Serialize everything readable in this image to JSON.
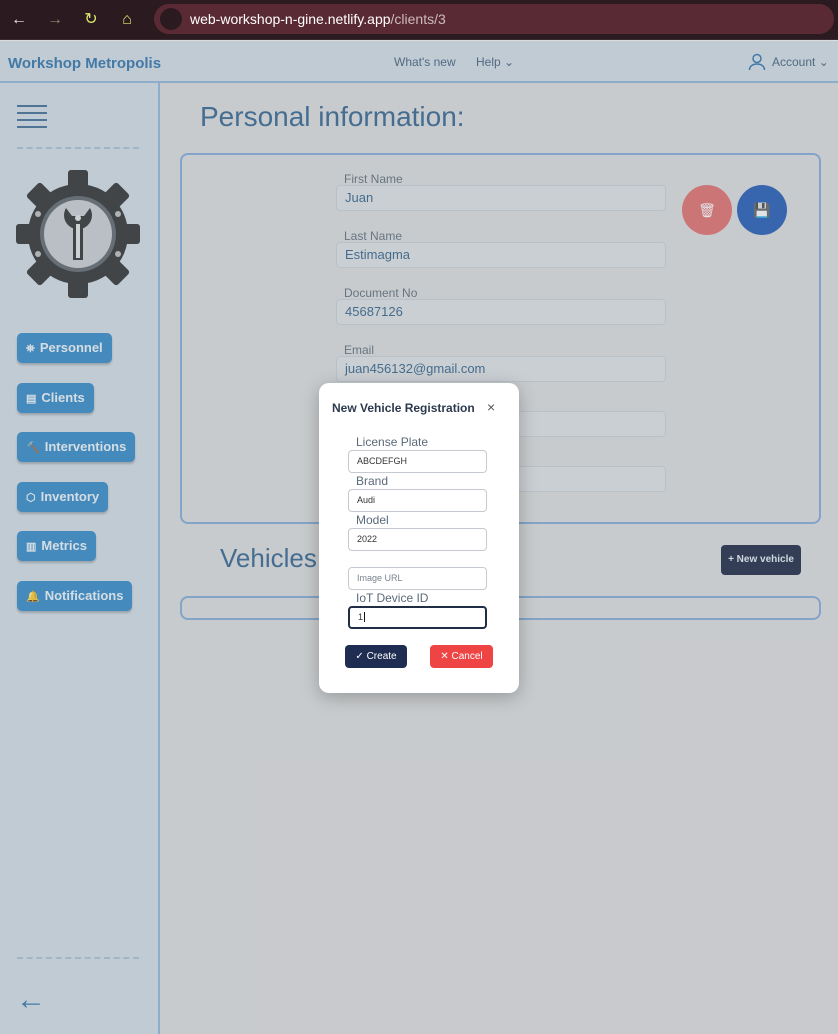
{
  "browser": {
    "url_host": "web-workshop-n-gine.netlify.app",
    "url_path": "/clients/3"
  },
  "app": {
    "brand": "Workshop Metropolis",
    "nav": [
      {
        "label": "What's new"
      },
      {
        "label": "Help"
      }
    ],
    "account_label": "Account"
  },
  "sidebar": {
    "items": [
      {
        "label": "Personnel",
        "icon": "⛯"
      },
      {
        "label": "Clients",
        "icon": "▤"
      },
      {
        "label": "Interventions",
        "icon": "🔨"
      },
      {
        "label": "Inventory",
        "icon": "⬡"
      },
      {
        "label": "Metrics",
        "icon": "▥"
      },
      {
        "label": "Notifications",
        "icon": "🔔"
      }
    ]
  },
  "main": {
    "title": "Personal information:",
    "fields": [
      {
        "label": "First Name",
        "value": "Juan"
      },
      {
        "label": "Last Name",
        "value": "Estimagma"
      },
      {
        "label": "Document No",
        "value": "45687126"
      },
      {
        "label": "Email",
        "value": "juan456132@gmail.com"
      }
    ],
    "vehicles_title": "Vehicles",
    "new_vehicle_label": "+ New vehicle",
    "colors": {
      "delete": "#e06a6a",
      "save": "#1b56b5"
    }
  },
  "modal": {
    "title": "New Vehicle Registration",
    "fields": [
      {
        "label": "License Plate",
        "value": "ABCDEFGH"
      },
      {
        "label": "Brand",
        "value": "Audi"
      },
      {
        "label": "Model",
        "value": "2022"
      },
      {
        "label": "",
        "placeholder": "Image URL"
      },
      {
        "label": "IoT Device ID",
        "value": "1"
      }
    ],
    "create_label": "Create",
    "cancel_label": "Cancel",
    "colors": {
      "create": "#1f2d52",
      "cancel": "#ef4444"
    }
  }
}
